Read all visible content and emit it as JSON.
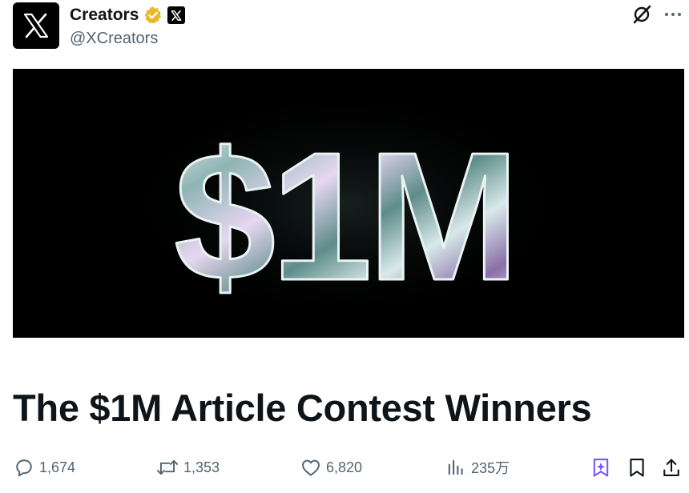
{
  "header": {
    "display_name": "Creators",
    "handle": "@XCreators",
    "avatar_icon": "x-logo-icon",
    "verified_badge_color": "#e8b829",
    "affiliate_icon": "x-logo-icon",
    "actions": [
      "grok-icon",
      "more-icon"
    ]
  },
  "banner": {
    "text": "$1M",
    "background": "#000000"
  },
  "article": {
    "title": "The $1M Article Contest Winners"
  },
  "engagement": {
    "replies": "1,674",
    "reposts": "1,353",
    "likes": "6,820",
    "views": "235万",
    "icons": [
      "reply-icon",
      "repost-icon",
      "like-icon",
      "views-icon",
      "grok-summary-icon",
      "bookmark-icon",
      "share-icon"
    ]
  },
  "colors": {
    "text": "#0f1419",
    "muted": "#536471",
    "accent_purple": "#7856ff"
  }
}
